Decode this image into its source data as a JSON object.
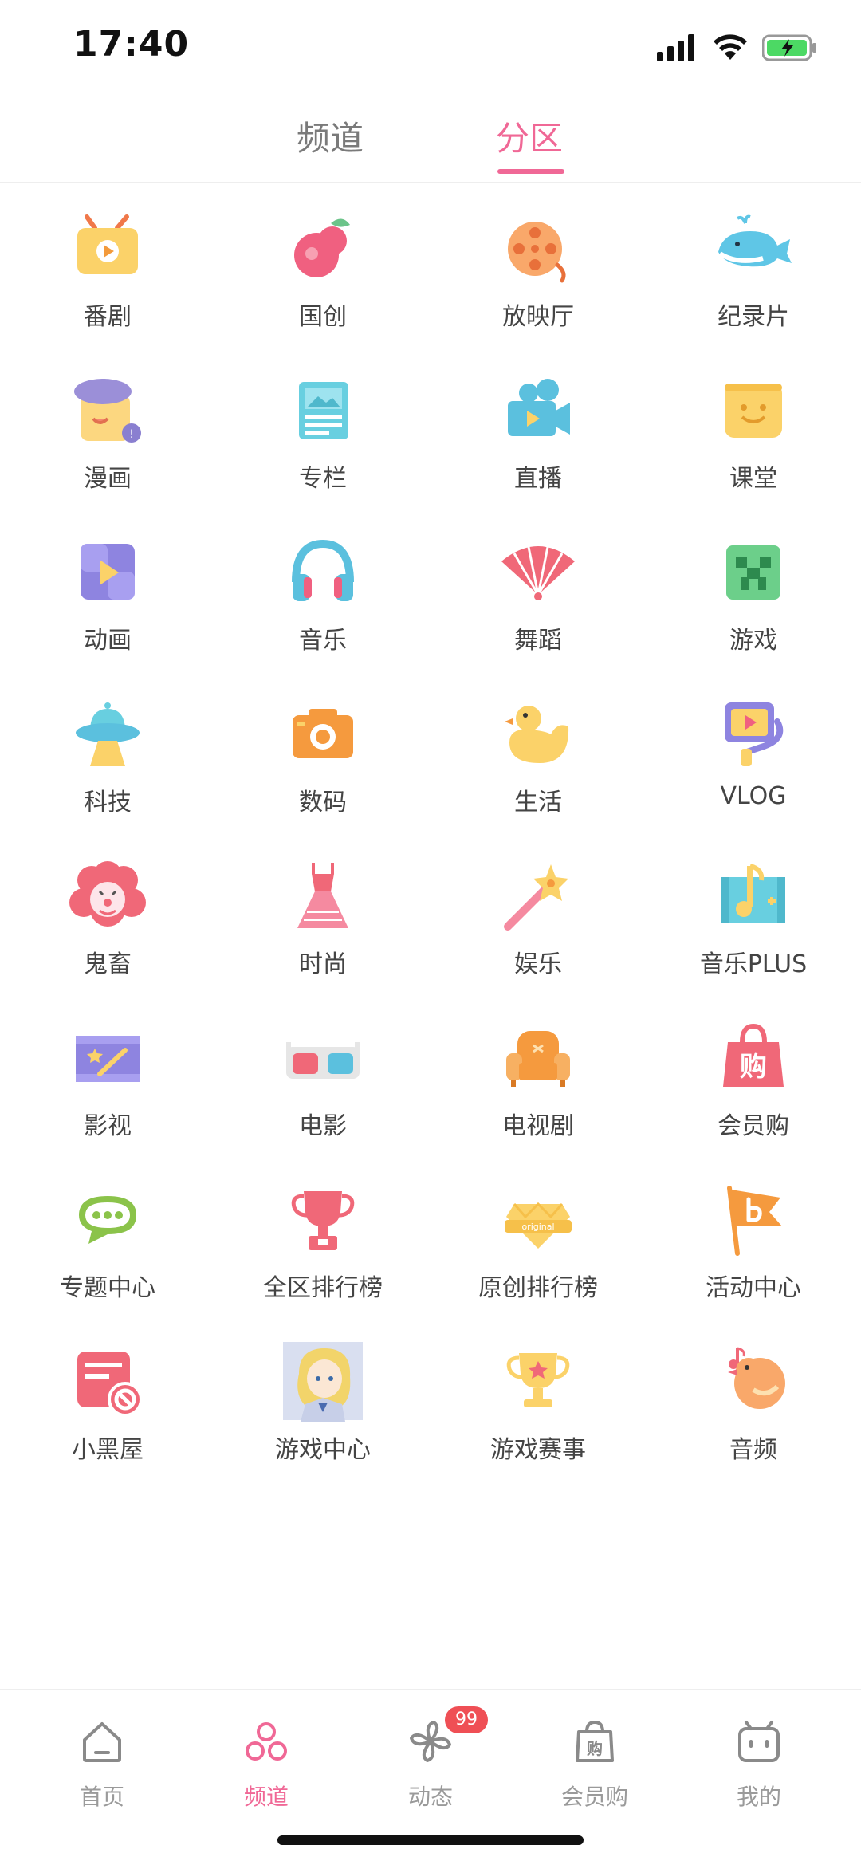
{
  "status_bar": {
    "time": "17:40"
  },
  "top_tabs": [
    {
      "label": "频道",
      "active": false
    },
    {
      "label": "分区",
      "active": true
    }
  ],
  "zones": [
    {
      "label": "番剧",
      "icon": "tv-icon"
    },
    {
      "label": "国创",
      "icon": "peach-icon"
    },
    {
      "label": "放映厅",
      "icon": "film-reel-icon"
    },
    {
      "label": "纪录片",
      "icon": "whale-icon"
    },
    {
      "label": "漫画",
      "icon": "comic-character-icon"
    },
    {
      "label": "专栏",
      "icon": "article-icon"
    },
    {
      "label": "直播",
      "icon": "video-camera-icon"
    },
    {
      "label": "课堂",
      "icon": "classroom-icon"
    },
    {
      "label": "动画",
      "icon": "animation-play-icon"
    },
    {
      "label": "音乐",
      "icon": "headphones-icon"
    },
    {
      "label": "舞蹈",
      "icon": "fan-icon"
    },
    {
      "label": "游戏",
      "icon": "creeper-icon"
    },
    {
      "label": "科技",
      "icon": "ufo-icon"
    },
    {
      "label": "数码",
      "icon": "camera-icon"
    },
    {
      "label": "生活",
      "icon": "duck-icon"
    },
    {
      "label": "VLOG",
      "icon": "vlog-camera-icon"
    },
    {
      "label": "鬼畜",
      "icon": "clown-icon"
    },
    {
      "label": "时尚",
      "icon": "dress-icon"
    },
    {
      "label": "娱乐",
      "icon": "magic-wand-icon"
    },
    {
      "label": "音乐PLUS",
      "icon": "music-film-icon"
    },
    {
      "label": "影视",
      "icon": "film-strip-icon"
    },
    {
      "label": "电影",
      "icon": "3d-glasses-icon"
    },
    {
      "label": "电视剧",
      "icon": "sofa-icon"
    },
    {
      "label": "会员购",
      "icon": "shopping-bag-icon"
    },
    {
      "label": "专题中心",
      "icon": "chat-bubble-icon"
    },
    {
      "label": "全区排行榜",
      "icon": "trophy-icon"
    },
    {
      "label": "原创排行榜",
      "icon": "original-gem-icon"
    },
    {
      "label": "活动中心",
      "icon": "flag-icon"
    },
    {
      "label": "小黑屋",
      "icon": "banned-icon"
    },
    {
      "label": "游戏中心",
      "icon": "anime-avatar-icon"
    },
    {
      "label": "游戏赛事",
      "icon": "star-trophy-icon"
    },
    {
      "label": "音频",
      "icon": "bird-icon"
    }
  ],
  "bottom_nav": [
    {
      "label": "首页",
      "icon": "home-icon",
      "active": false
    },
    {
      "label": "频道",
      "icon": "channel-icon",
      "active": true
    },
    {
      "label": "动态",
      "icon": "pinwheel-icon",
      "active": false,
      "badge": "99"
    },
    {
      "label": "会员购",
      "icon": "member-shop-icon",
      "active": false
    },
    {
      "label": "我的",
      "icon": "profile-tv-icon",
      "active": false
    }
  ],
  "colors": {
    "accent": "#f06896",
    "badge": "#ef4f55"
  }
}
